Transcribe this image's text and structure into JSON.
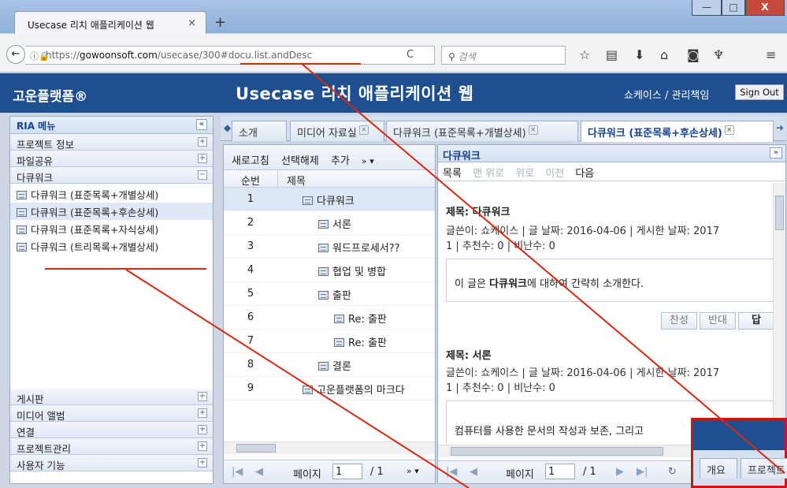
{
  "browser": {
    "tab_title": "Usecase 리치 애플리케이션 웹",
    "tab_close": "×",
    "new_tab": "+",
    "url_prefix": "https://",
    "url_host": "gowoonsoft.com",
    "url_path": "/usecase/300#docu.list.andDesc",
    "search_placeholder": "검색",
    "window_buttons": [
      "—",
      "□",
      "X"
    ]
  },
  "header": {
    "brand": "고운플랫폼®",
    "title": "Usecase 리치 애플리케이션 웹",
    "user": "쇼케이스 / 관리책임",
    "sign_out": "Sign Out"
  },
  "left_panel": {
    "title": "RIA 메뉴",
    "collapse": "«",
    "top_items": [
      {
        "label": "프로젝트 정보",
        "toggle": "+"
      },
      {
        "label": "파일공유",
        "toggle": "+"
      },
      {
        "label": "다큐워크",
        "toggle": "−"
      }
    ],
    "tree_items": [
      "다큐워크 (표준목록+개별상세)",
      "다큐워크 (표준목록+후손상세)",
      "다큐워크 (표준목록+자식상세)",
      "다큐워크 (트리목록+개별상세)"
    ],
    "bottom_items": [
      {
        "label": "게시판",
        "toggle": "+"
      },
      {
        "label": "미디어 앨범",
        "toggle": "+"
      },
      {
        "label": "연결",
        "toggle": "+"
      },
      {
        "label": "프로젝트관리",
        "toggle": "+"
      },
      {
        "label": "사용자 기능",
        "toggle": "+"
      }
    ]
  },
  "tabs": [
    {
      "label": "소개",
      "close": "×"
    },
    {
      "label": "미디어 자료실",
      "close": "×"
    },
    {
      "label": "다큐워크 (표준목록+개별상세)",
      "close": "×"
    },
    {
      "label": "다큐워크 (표준목록+후손상세)",
      "close": "×"
    }
  ],
  "list_panel": {
    "toolbar": [
      "새로고침",
      "선택해제",
      "추가",
      "» ▾"
    ],
    "col_num": "순번",
    "col_title": "제목",
    "rows": [
      {
        "num": "1",
        "title": "다큐워크"
      },
      {
        "num": "2",
        "title": "서론"
      },
      {
        "num": "3",
        "title": "워드프로세서??"
      },
      {
        "num": "4",
        "title": "협업 및 병합"
      },
      {
        "num": "5",
        "title": "출판"
      },
      {
        "num": "6",
        "title": "Re: 출판"
      },
      {
        "num": "7",
        "title": "Re: 출판"
      },
      {
        "num": "8",
        "title": "결론"
      },
      {
        "num": "9",
        "title": "고운플랫폼의 마크다"
      }
    ],
    "pager_label": "페이지",
    "page": "1",
    "total": "/ 1",
    "more": "» ▾"
  },
  "detail_panel": {
    "title": "다큐워크",
    "nav": [
      "목록",
      "맨 위로",
      "위로",
      "이전",
      "다음"
    ],
    "posts": [
      {
        "title": "제목: 다큐워크",
        "meta1": "글쓴이: 쇼케이스 | 글 날짜: 2016-04-06 | 게시한 날짜: 2017",
        "meta2": "1 | 추천수: 0 | 비난수: 0",
        "body_pre": "이 글은 ",
        "body_bold": "다큐워크",
        "body_post": "에 대하여 간략히 소개한다."
      },
      {
        "title": "제목: 서론",
        "meta1": "글쓴이: 쇼케이스 | 글 날짜: 2016-04-06 | 게시한 날짜: 2017",
        "meta2": "1 | 추천수: 0 | 비난수: 0",
        "body": "컴퓨터를 사용한 문서의 작성과 보존, 그리고"
      }
    ],
    "vote_buttons": [
      "찬성",
      "반대",
      "답"
    ],
    "pager_label": "페이지",
    "page": "1",
    "total": "/ 1"
  },
  "overlay_window": {
    "tabs": [
      "개요",
      "프로젝트"
    ]
  },
  "colors": {
    "header_bg": "#1f4f8e",
    "annotation": "#d42a14",
    "overlay_border": "#d4101b"
  }
}
